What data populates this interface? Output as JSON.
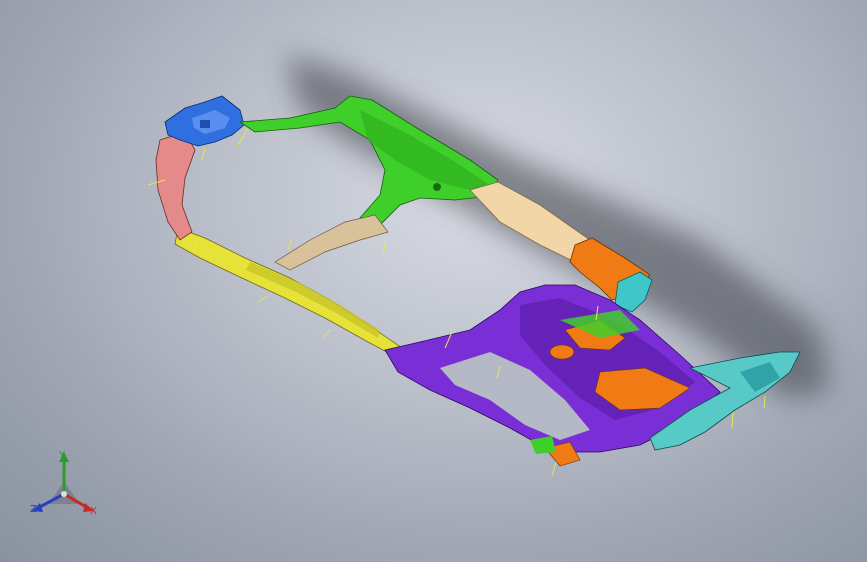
{
  "view": {
    "background_top": "#d8dbe3",
    "background_bottom": "#8a92a1"
  },
  "model": {
    "part_colors": {
      "blue_bracket": "#2f6fe0",
      "pink_bracket": "#e58a8a",
      "green_beam": "#3fcf2a",
      "beige_panel": "#f2d6a8",
      "tan_strip": "#d9c29a",
      "yellow_rail": "#e6e23a",
      "purple_frame": "#7a2fd6",
      "orange_part": "#f07a14",
      "cyan_part": "#3fc6c9",
      "teal_end": "#57c9c6",
      "annotation_line": "#e6e84a"
    }
  },
  "triad": {
    "y_label": "Y",
    "z_label": "Z",
    "x_label": "X",
    "y_color": "#2e9a2e",
    "z_color": "#2a3fbf",
    "x_color": "#c42a2a"
  }
}
